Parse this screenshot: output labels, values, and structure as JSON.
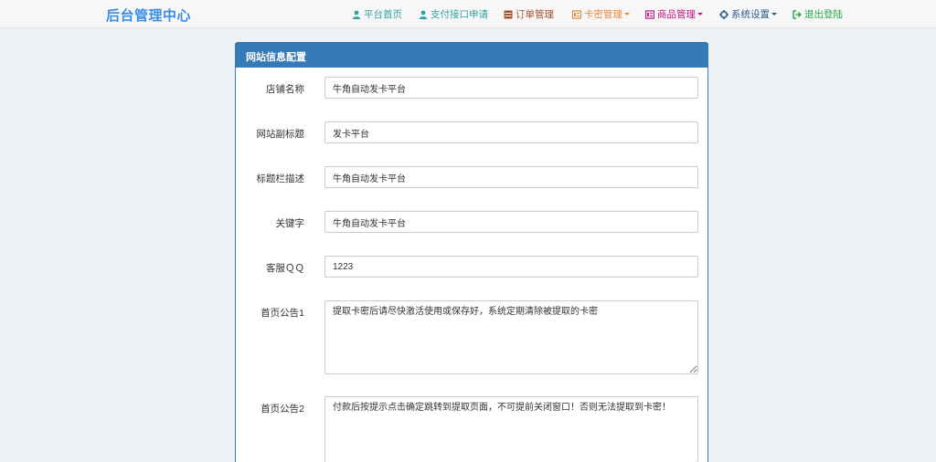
{
  "brand": "后台管理中心",
  "nav": [
    {
      "label": "平台首页",
      "icon": "user-icon",
      "color": "#31a3a0",
      "dropdown": false
    },
    {
      "label": "支付接口申请",
      "icon": "user-icon",
      "color": "#31a3a0",
      "dropdown": false
    },
    {
      "label": "订单管理",
      "icon": "list-icon",
      "color": "#a0522d",
      "dropdown": false
    },
    {
      "label": "卡密管理",
      "icon": "card-icon",
      "color": "#e8883a",
      "dropdown": true
    },
    {
      "label": "商品管理",
      "icon": "card-icon",
      "color": "#c71585",
      "dropdown": true
    },
    {
      "label": "系统设置",
      "icon": "gear-icon",
      "color": "#2a5c8a",
      "dropdown": true
    },
    {
      "label": "退出登陆",
      "icon": "logout-icon",
      "color": "#28a745",
      "dropdown": false
    }
  ],
  "panel": {
    "title": "网站信息配置",
    "fields": [
      {
        "label": "店铺名称",
        "value": "牛角自动发卡平台"
      },
      {
        "label": "网站副标题",
        "value": "发卡平台"
      },
      {
        "label": "标题栏描述",
        "value": "牛角自动发卡平台"
      },
      {
        "label": "关键字",
        "value": "牛角自动发卡平台"
      },
      {
        "label": "客服ＱＱ",
        "value": "1223"
      }
    ],
    "notices": [
      {
        "label": "首页公告1",
        "value": "提取卡密后请尽快激活使用或保存好，系统定期清除被提取的卡密"
      },
      {
        "label": "首页公告2",
        "value": "付款后按提示点击确定跳转到提取页面，不可提前关闭窗口！否则无法提取到卡密！"
      }
    ]
  }
}
